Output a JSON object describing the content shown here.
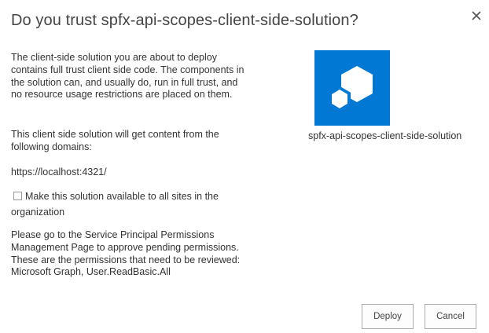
{
  "dialog": {
    "title": "Do you trust spfx-api-scopes-client-side-solution?",
    "close_icon": "close-icon"
  },
  "body": {
    "paragraph_1": "The client-side solution you are about to deploy contains full trust client side code. The components in the solution can, and usually do, run in full trust, and no resource usage restrictions are placed on them.",
    "paragraph_2": "This client side solution will get content from the following domains:",
    "domain": "https://localhost:4321/",
    "checkbox_label_line1": "Make this solution available to all sites in the",
    "checkbox_label_line2": "organization",
    "checkbox_checked": false,
    "paragraph_4": "Please go to the Service Principal Permissions Management Page to approve pending permissions. These are the permissions that need to be reviewed: Microsoft Graph, User.ReadBasic.All"
  },
  "solution": {
    "name": "spfx-api-scopes-client-side-solution",
    "logo_icon": "spfx-hexagon-logo-icon",
    "logo_color": "#0078d4"
  },
  "buttons": {
    "deploy": "Deploy",
    "cancel": "Cancel"
  }
}
